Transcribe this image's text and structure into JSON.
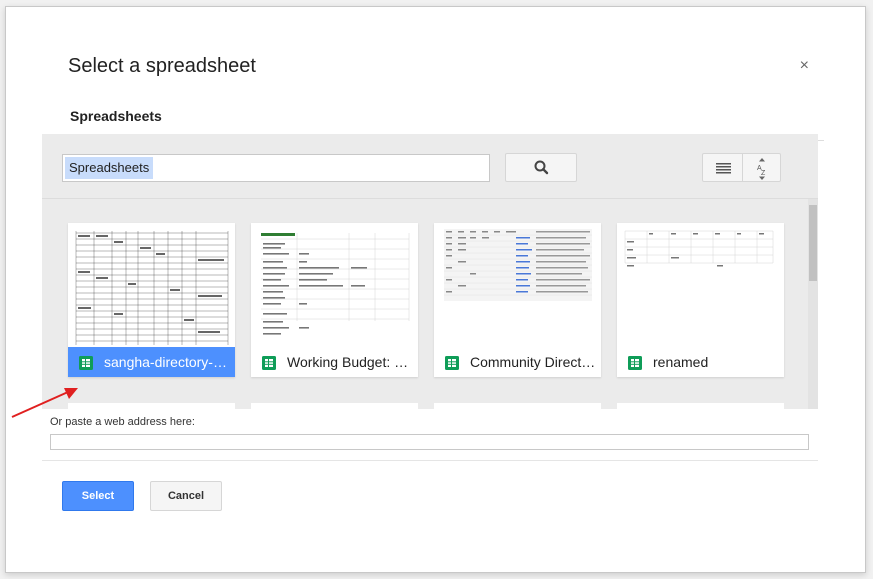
{
  "dialog": {
    "title": "Select a spreadsheet",
    "close_label": "×",
    "tabs": [
      {
        "label": "Spreadsheets",
        "active": true
      }
    ]
  },
  "search": {
    "value": "Spreadsheets",
    "placeholder": ""
  },
  "files": [
    {
      "name": "sangha-directory-n…",
      "selected": true
    },
    {
      "name": "Working Budget: 2…",
      "selected": false
    },
    {
      "name": "Community Direct…",
      "selected": false
    },
    {
      "name": "renamed",
      "selected": false
    }
  ],
  "paste": {
    "label": "Or paste a web address here:",
    "value": ""
  },
  "buttons": {
    "select_label": "Select",
    "cancel_label": "Cancel"
  },
  "icons": {
    "search": "search-icon",
    "list_view": "list-view-icon",
    "sort": "sort-az-icon",
    "sheet": "spreadsheet-icon",
    "close": "close-icon"
  },
  "colors": {
    "accent": "#4d90fe",
    "sheets_green": "#0f9d58",
    "annotation_arrow": "#e02020"
  }
}
